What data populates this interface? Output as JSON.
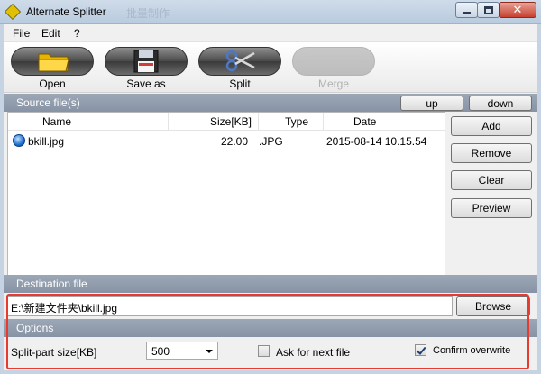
{
  "window": {
    "title": "Alternate Splitter",
    "title_ghost": "批量制作",
    "controls": {
      "minimize": "minimize",
      "maximize": "maximize",
      "close": "✕"
    }
  },
  "menu": [
    {
      "label": "File"
    },
    {
      "label": "Edit"
    },
    {
      "label": "?"
    }
  ],
  "toolbar": {
    "open": "Open",
    "save_as": "Save as",
    "split": "Split",
    "merge": "Merge"
  },
  "source": {
    "header": "Source file(s)",
    "up": "up",
    "down": "down",
    "columns": {
      "name": "Name",
      "size": "Size[KB]",
      "type": "Type",
      "date": "Date"
    },
    "rows": [
      {
        "name": "bkill.jpg",
        "size": "22.00",
        "type": ".JPG",
        "date": "2015-08-14 10.15.54"
      }
    ],
    "buttons": {
      "add": "Add",
      "remove": "Remove",
      "clear": "Clear",
      "preview": "Preview"
    }
  },
  "destination": {
    "header": "Destination file",
    "path": "E:\\新建文件夹\\bkill.jpg",
    "browse": "Browse"
  },
  "options": {
    "header": "Options",
    "split_size_label": "Split-part size[KB]",
    "split_size_value": "500",
    "ask_next_label": "Ask for next file",
    "ask_next_checked": false,
    "confirm_overwrite_label": "Confirm overwrite",
    "confirm_overwrite_checked": true
  },
  "colors": {
    "section_header": "#8f9bab",
    "highlight": "#e63b2e",
    "close_button": "#c7402f"
  }
}
